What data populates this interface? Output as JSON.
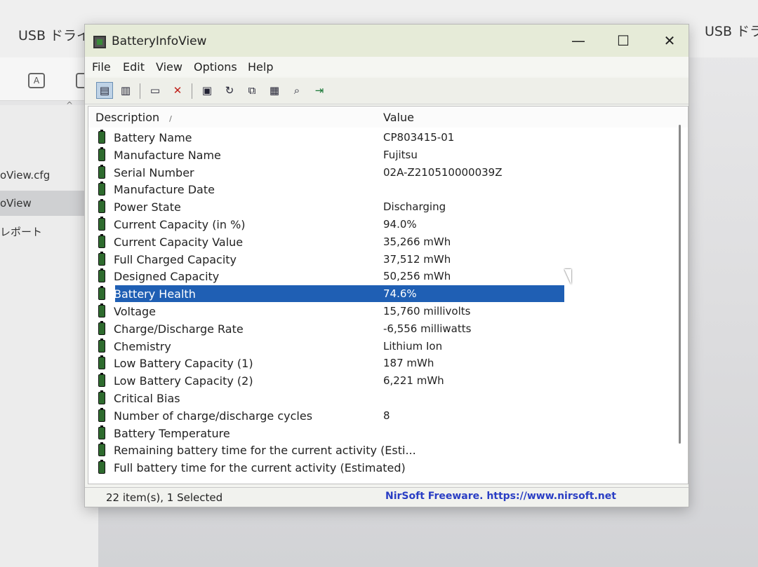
{
  "background": {
    "title_left": "USB ドライブ",
    "title_right": "USB ドライ",
    "files": [
      "oView.cfg",
      "oView",
      "レポート"
    ]
  },
  "window": {
    "title": "BatteryInfoView",
    "minimize": "—",
    "maximize": "☐",
    "close": "✕"
  },
  "menu": [
    "File",
    "Edit",
    "View",
    "Options",
    "Help"
  ],
  "toolbar": {
    "icons": [
      "view-icon",
      "report-icon",
      "properties-icon",
      "delete-icon",
      "save-icon",
      "refresh-icon",
      "copy-icon",
      "options-icon",
      "find-icon",
      "exit-icon"
    ]
  },
  "list": {
    "columns": [
      "Description",
      "Value"
    ],
    "rows": [
      {
        "desc": "Battery Name",
        "value": "CP803415-01"
      },
      {
        "desc": "Manufacture Name",
        "value": "Fujitsu"
      },
      {
        "desc": "Serial Number",
        "value": "02A-Z210510000039Z"
      },
      {
        "desc": "Manufacture Date",
        "value": ""
      },
      {
        "desc": "Power State",
        "value": "Discharging"
      },
      {
        "desc": "Current Capacity (in %)",
        "value": "94.0%"
      },
      {
        "desc": "Current Capacity Value",
        "value": "35,266 mWh"
      },
      {
        "desc": "Full Charged Capacity",
        "value": "37,512 mWh"
      },
      {
        "desc": "Designed Capacity",
        "value": "50,256 mWh"
      },
      {
        "desc": "Battery Health",
        "value": "74.6%",
        "selected": true
      },
      {
        "desc": "Voltage",
        "value": "15,760 millivolts"
      },
      {
        "desc": "Charge/Discharge Rate",
        "value": "-6,556 milliwatts"
      },
      {
        "desc": "Chemistry",
        "value": "Lithium Ion"
      },
      {
        "desc": "Low Battery Capacity (1)",
        "value": "187 mWh"
      },
      {
        "desc": "Low Battery Capacity (2)",
        "value": "6,221 mWh"
      },
      {
        "desc": "Critical Bias",
        "value": ""
      },
      {
        "desc": "Number of charge/discharge cycles",
        "value": "8"
      },
      {
        "desc": "Battery Temperature",
        "value": ""
      },
      {
        "desc": "Remaining battery time for the current activity (Esti...",
        "value": ""
      },
      {
        "desc": "Full battery time for the current activity (Estimated)",
        "value": ""
      }
    ]
  },
  "status": {
    "items": "22 item(s), 1 Selected",
    "credit": "NirSoft Freeware. https://www.nirsoft.net"
  },
  "colors": {
    "selection": "#1f5fb4",
    "battery_icon": "#2e6b2e",
    "credit_text": "#2a3ec4"
  }
}
